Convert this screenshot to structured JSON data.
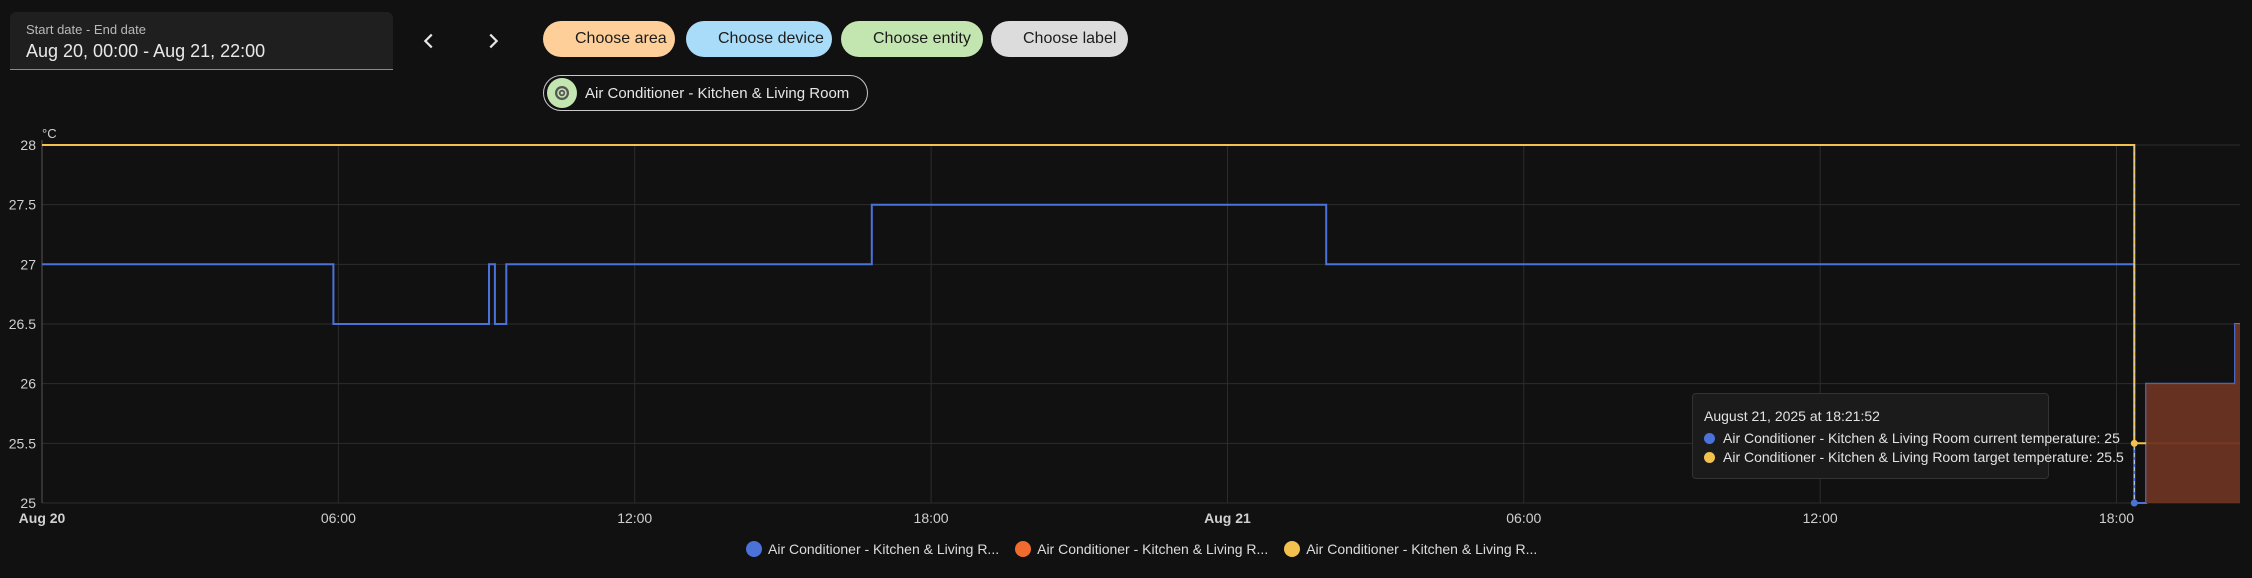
{
  "date_range": {
    "label": "Start date - End date",
    "value": "Aug 20, 00:00 - Aug 21, 22:00"
  },
  "filters": {
    "area": "Choose area",
    "device": "Choose device",
    "entity": "Choose entity",
    "label": "Choose label"
  },
  "selected_entity": "Air Conditioner - Kitchen & Living Room",
  "tooltip": {
    "title": "August 21, 2025 at 18:21:52",
    "rows": [
      "Air Conditioner - Kitchen & Living Room current temperature: 25",
      "Air Conditioner - Kitchen & Living Room target temperature: 25.5"
    ]
  },
  "legend": [
    "Air Conditioner - Kitchen & Living R...",
    "Air Conditioner - Kitchen & Living R...",
    "Air Conditioner - Kitchen & Living R..."
  ],
  "colors": {
    "current": "#4a72d8",
    "heating": "#f26b2e",
    "target": "#f2c14e",
    "heating_fill": "#6b3422"
  },
  "chart_data": {
    "type": "line",
    "unit": "°C",
    "x_range_hours": [
      0,
      44.5
    ],
    "ylim": [
      25,
      28
    ],
    "y_ticks": [
      25,
      25.5,
      26,
      26.5,
      27,
      27.5,
      28
    ],
    "x_ticks": [
      {
        "h": 0,
        "label": "Aug 20",
        "bold": true
      },
      {
        "h": 6,
        "label": "06:00",
        "bold": false
      },
      {
        "h": 12,
        "label": "12:00",
        "bold": false
      },
      {
        "h": 18,
        "label": "18:00",
        "bold": false
      },
      {
        "h": 24,
        "label": "Aug 21",
        "bold": true
      },
      {
        "h": 30,
        "label": "06:00",
        "bold": false
      },
      {
        "h": 36,
        "label": "12:00",
        "bold": false
      },
      {
        "h": 42,
        "label": "18:00",
        "bold": false
      }
    ],
    "grid": true,
    "series": [
      {
        "key": "current",
        "step": true,
        "points": [
          [
            0,
            27
          ],
          [
            5.9,
            27
          ],
          [
            5.9,
            26.5
          ],
          [
            9.05,
            26.5
          ],
          [
            9.05,
            27
          ],
          [
            9.17,
            27
          ],
          [
            9.17,
            26.5
          ],
          [
            9.4,
            26.5
          ],
          [
            9.4,
            27
          ],
          [
            16.8,
            27
          ],
          [
            16.8,
            27.5
          ],
          [
            26.0,
            27.5
          ],
          [
            26.0,
            27
          ],
          [
            42.36,
            27
          ],
          [
            42.36,
            25
          ],
          [
            42.6,
            25
          ],
          [
            42.6,
            26
          ],
          [
            44.4,
            26
          ],
          [
            44.4,
            26.5
          ],
          [
            44.5,
            26.5
          ]
        ]
      },
      {
        "key": "target",
        "step": true,
        "points": [
          [
            0,
            28
          ],
          [
            42.36,
            28
          ],
          [
            42.36,
            25.5
          ],
          [
            44.5,
            25.5
          ]
        ]
      },
      {
        "key": "heating",
        "step": true,
        "fill": true,
        "points": [
          [
            42.6,
            26
          ],
          [
            44.4,
            26
          ],
          [
            44.4,
            26.5
          ],
          [
            44.5,
            26.5
          ]
        ]
      }
    ],
    "cursor_h": 42.36
  }
}
